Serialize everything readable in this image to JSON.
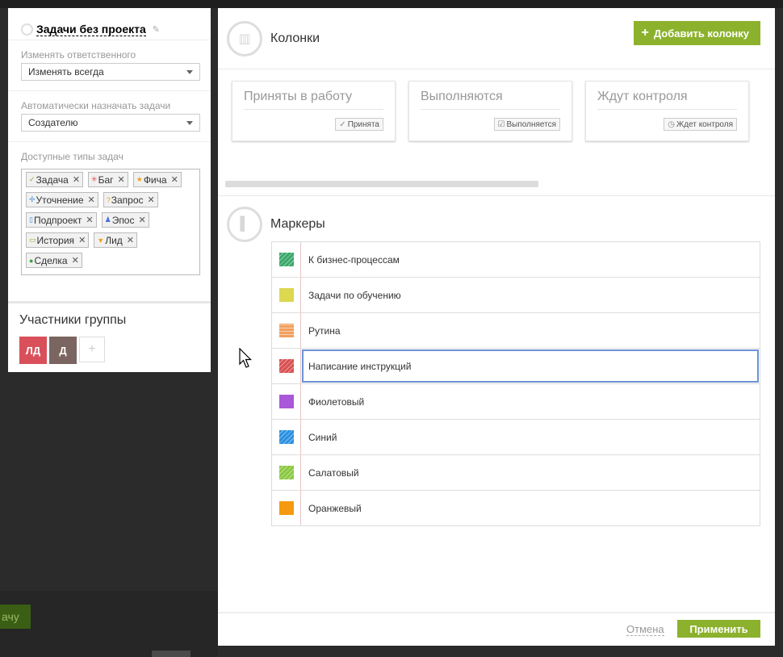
{
  "background": {
    "btn_label": "ачу"
  },
  "left_panel": {
    "project_title": "Задачи без проекта",
    "responsible": {
      "label": "Изменять ответственного",
      "value": "Изменять всегда"
    },
    "auto_assign": {
      "label": "Автоматически назначать задачи",
      "value": "Создателю"
    },
    "task_types": {
      "label": "Доступные типы задач",
      "items": [
        {
          "label": "Задача",
          "icon": "✓",
          "color": "#8cb22d"
        },
        {
          "label": "Баг",
          "icon": "✳",
          "color": "#e05050"
        },
        {
          "label": "Фича",
          "icon": "★",
          "color": "#f0a020"
        },
        {
          "label": "Уточнение",
          "icon": "✢",
          "color": "#4a90d9"
        },
        {
          "label": "Запрос",
          "icon": "?",
          "color": "#f0a020"
        },
        {
          "label": "Подпроект",
          "icon": "▯",
          "color": "#4a90d9"
        },
        {
          "label": "Эпос",
          "icon": "♟",
          "color": "#4a6fd9"
        },
        {
          "label": "История",
          "icon": "▭",
          "color": "#8cb22d"
        },
        {
          "label": "Лид",
          "icon": "▼",
          "color": "#f0a020"
        },
        {
          "label": "Сделка",
          "icon": "●",
          "color": "#3aa03a"
        }
      ]
    },
    "members": {
      "title": "Участники группы",
      "avatars": [
        {
          "initials": "ЛД",
          "color": "#d9505a"
        },
        {
          "initials": "Д",
          "color": "#7a6560"
        }
      ],
      "add_label": "+"
    }
  },
  "columns": {
    "title": "Колонки",
    "add_button": "Добавить колонку",
    "items": [
      {
        "title": "Приняты в работу",
        "badge": "Принята",
        "icon": "✓"
      },
      {
        "title": "Выполняются",
        "badge": "Выполняется",
        "icon": "☑"
      },
      {
        "title": "Ждут контроля",
        "badge": "Ждет контроля",
        "icon": "◷"
      }
    ]
  },
  "markers": {
    "title": "Маркеры",
    "items": [
      {
        "label": "К бизнес-процессам",
        "color": "#3aa86a",
        "pattern": "diagonal"
      },
      {
        "label": "Задачи по обучению",
        "color": "#dcd850",
        "pattern": "solid"
      },
      {
        "label": "Рутина",
        "color": "#f0a060",
        "pattern": "horizontal"
      },
      {
        "label": "Написание инструкций",
        "color": "#d85050",
        "pattern": "diagonal",
        "active": true
      },
      {
        "label": "Фиолетовый",
        "color": "#a858d8",
        "pattern": "solid"
      },
      {
        "label": "Синий",
        "color": "#2a90e0",
        "pattern": "diagonal"
      },
      {
        "label": "Салатовый",
        "color": "#8ac840",
        "pattern": "diagonal"
      },
      {
        "label": "Оранжевый",
        "color": "#f59a10",
        "pattern": "solid"
      }
    ]
  },
  "footer": {
    "cancel": "Отмена",
    "apply": "Применить"
  }
}
